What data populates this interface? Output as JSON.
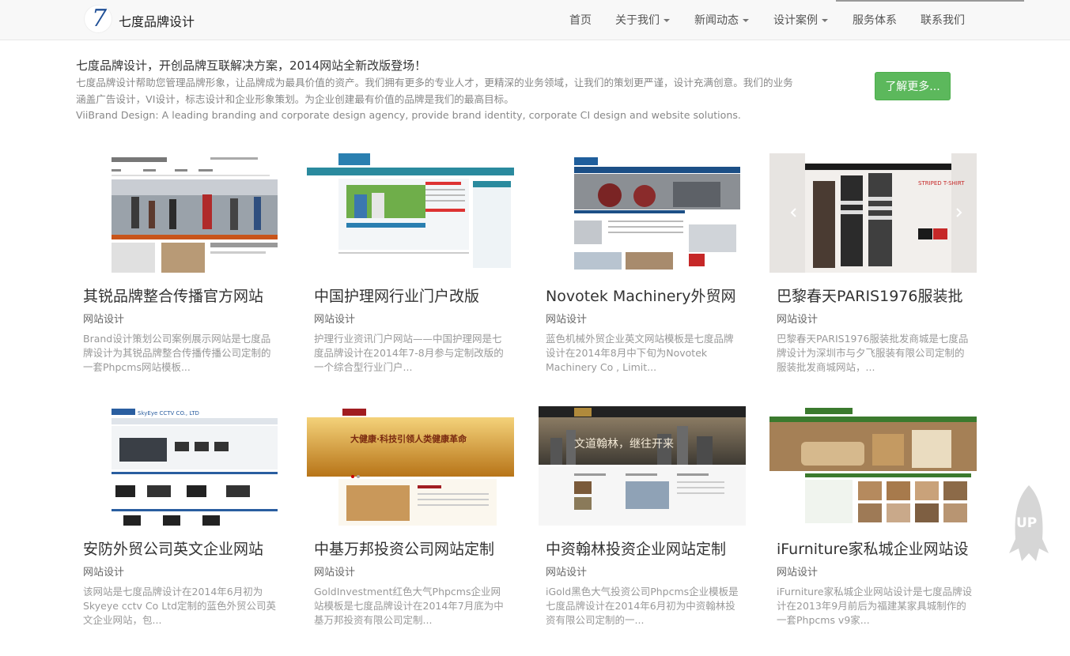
{
  "header": {
    "logo_glyph": "7",
    "brand": "七度品牌设计",
    "nav": [
      {
        "label": "首页",
        "dropdown": false
      },
      {
        "label": "关于我们",
        "dropdown": true
      },
      {
        "label": "新闻动态",
        "dropdown": true
      },
      {
        "label": "设计案例",
        "dropdown": true
      },
      {
        "label": "服务体系",
        "dropdown": false
      },
      {
        "label": "联系我们",
        "dropdown": false
      }
    ]
  },
  "intro": {
    "title": "七度品牌设计，开创品牌互联解决方案，2014网站全新改版登场！",
    "desc_line1": "七度品牌设计帮助您管理品牌形象，让品牌成为最具价值的资产。我们拥有更多的专业人才，更精深的业务领域，让我们的策划更严谨，设计充满创意。我们的业务",
    "desc_line2": "涵盖广告设计，VI设计，标志设计和企业形象策划。为企业创建最有价值的品牌是我们的最高目标。",
    "desc_line3": "ViiBrand Design: A leading branding and corporate design agency, provide brand identity, corporate CI design and website solutions.",
    "more_button": "了解更多..."
  },
  "cases": [
    {
      "title": "其锐品牌整合传播官方网站",
      "category": "网站设计",
      "desc": "Brand设计策划公司案例展示网站是七度品牌设计为其锐品牌整合传播传播公司定制的一套Phpcms网站模板..."
    },
    {
      "title": "中国护理网行业门户改版",
      "category": "网站设计",
      "desc": "护理行业资讯门户网站——中国护理网是七度品牌设计在2014年7-8月参与定制改版的一个综合型行业门户..."
    },
    {
      "title": "Novotek Machinery外贸网",
      "category": "网站设计",
      "desc": "蓝色机械外贸企业英文网站模板是七度品牌设计在2014年8月中下旬为Novotek Machinery Co , Limit..."
    },
    {
      "title": "巴黎春天PARIS1976服装批",
      "category": "网站设计",
      "desc": "巴黎春天PARIS1976服装批发商城是七度品牌设计为深圳市与夕飞服装有限公司定制的服装批发商城网站，..."
    },
    {
      "title": "安防外贸公司英文企业网站",
      "category": "网站设计",
      "desc": "该网站是七度品牌设计在2014年6月初为Skyeye cctv Co Ltd定制的蓝色外贸公司英文企业网站，包..."
    },
    {
      "title": "中基万邦投资公司网站定制",
      "category": "网站设计",
      "desc": "GoldInvestment红色大气Phpcms企业网站模板是七度品牌设计在2014年7月底为中基万邦投资有限公司定制..."
    },
    {
      "title": "中资翰林投资企业网站定制",
      "category": "网站设计",
      "desc": "iGold黑色大气投资公司Phpcms企业模板是七度品牌设计在2014年6月初为中资翰林投资有限公司定制的一..."
    },
    {
      "title": "iFurniture家私城企业网站设",
      "category": "网站设计",
      "desc": "iFurniture家私城企业网站设计是七度品牌设计在2013年9月前后为福建某家具城制作的一套Phpcms v9家..."
    }
  ],
  "thumb_text": {
    "skyeye": "SkyEye CCTV CO., LTD",
    "goldinv_slogan": "大健康·科技引领人类健康革命",
    "igold_slogan": "文道翰林，继往开来",
    "paris_striped": "STRIPED T-SHIRT"
  },
  "back_to_top": "UP",
  "colors": {
    "accent_green": "#5cb85c",
    "nav_bg": "#f8f8f8",
    "logo_blue": "#1f4f96"
  }
}
